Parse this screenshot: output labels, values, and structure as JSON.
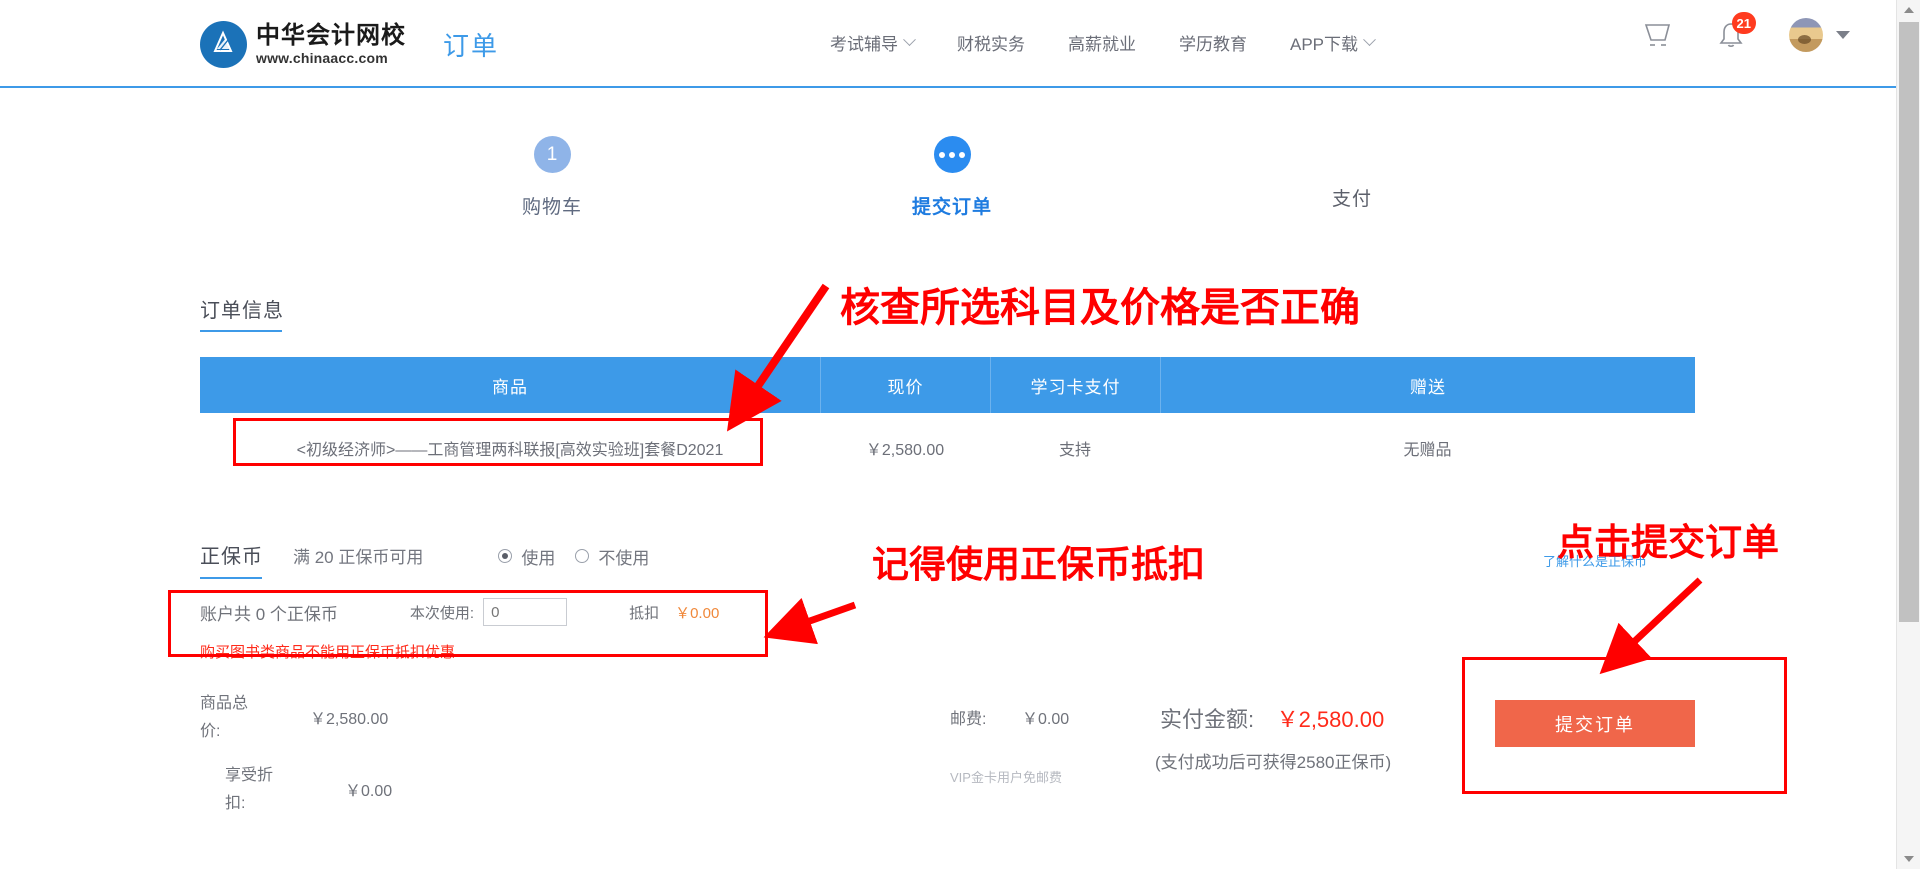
{
  "header": {
    "logo_cn": "中华会计网校",
    "logo_url": "www.chinaacc.com",
    "page_kind": "订单",
    "nav": [
      {
        "label": "考试辅导",
        "has_caret": true
      },
      {
        "label": "财税实务",
        "has_caret": false
      },
      {
        "label": "高薪就业",
        "has_caret": false
      },
      {
        "label": "学历教育",
        "has_caret": false
      },
      {
        "label": "APP下载",
        "has_caret": true
      }
    ],
    "cart_icon": "shopping-cart-icon",
    "bell_icon": "bell-icon",
    "notification_count": "21",
    "avatar_icon": "avatar"
  },
  "steps": [
    {
      "marker": "1",
      "label": "购物车",
      "state": "done"
    },
    {
      "marker": "···",
      "label": "提交订单",
      "state": "active"
    },
    {
      "marker": "",
      "label": "支付",
      "state": "pending"
    }
  ],
  "order_section": {
    "title": "订单信息",
    "columns": [
      "商品",
      "现价",
      "学习卡支付",
      "赠送"
    ],
    "rows": [
      {
        "product": "<初级经济师>——工商管理两科联报[高效实验班]套餐D2021",
        "price": "￥2,580.00",
        "card_pay": "支持",
        "gift": "无赠品"
      }
    ]
  },
  "coin_section": {
    "title": "正保币",
    "rule": "满 20 正保币可用",
    "radio_use": "使用",
    "radio_not_use": "不使用",
    "selected": "使用",
    "account_text": "账户共 0 个正保币",
    "use_label": "本次使用:",
    "use_value": "",
    "use_placeholder": "0",
    "deduct_label": "抵扣",
    "deduct_value": "￥0.00",
    "warning": "购买图书类商品不能用正保币抵扣优惠",
    "link": "了解什么是正保币"
  },
  "totals": {
    "goods_total_label": "商品总价:",
    "goods_total_value": "￥2,580.00",
    "discount_label": "享受折扣:",
    "discount_value": "￥0.00",
    "shipping_label": "邮费:",
    "shipping_value": "￥0.00",
    "shipping_note": "VIP金卡用户免邮费",
    "pay_label": "实付金额:",
    "pay_value": "￥2,580.00",
    "pay_note": "(支付成功后可获得2580正保币)",
    "submit_label": "提交订单"
  },
  "annotations": [
    {
      "id": "check-subject",
      "text": "核查所选科目及价格是否正确"
    },
    {
      "id": "use-coin",
      "text": "记得使用正保币抵扣"
    },
    {
      "id": "click-submit",
      "text": "点击提交订单"
    }
  ],
  "colors": {
    "brand_blue": "#3d9ae8",
    "active_blue": "#2b8cf0",
    "submit_orange": "#f0664a",
    "annotation_red": "#ff0000",
    "warning_red": "#ff2a1a"
  }
}
